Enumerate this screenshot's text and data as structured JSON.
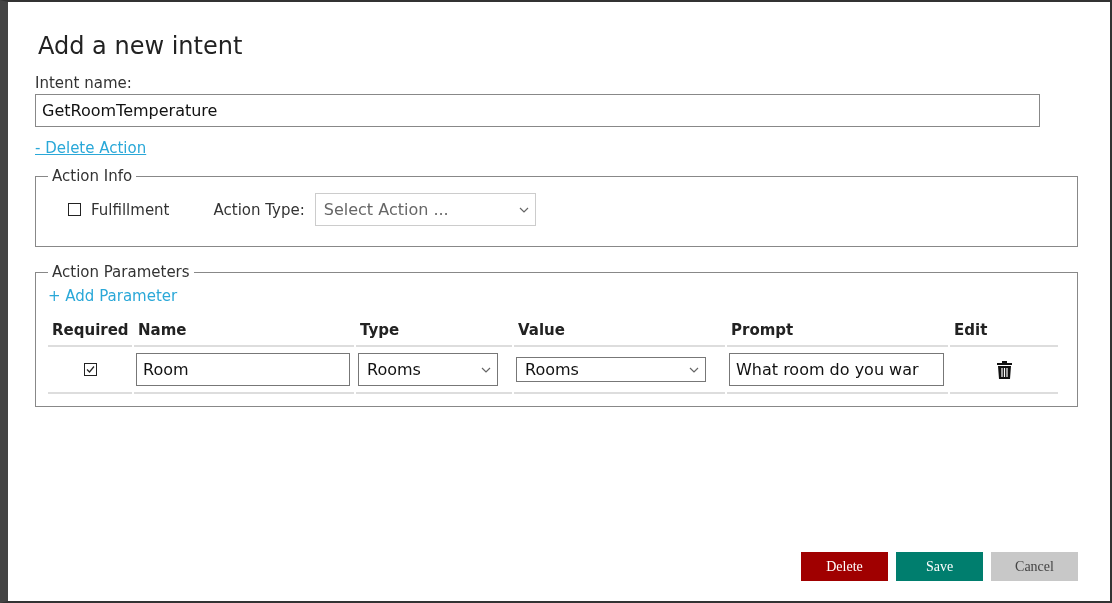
{
  "dialog": {
    "title": "Add a new intent"
  },
  "intent_name": {
    "label": "Intent name:",
    "value": "GetRoomTemperature"
  },
  "delete_action_link": "- Delete Action",
  "action_info": {
    "legend": "Action Info",
    "fulfillment": {
      "label": "Fulfillment",
      "checked": false
    },
    "action_type": {
      "label": "Action Type:",
      "placeholder": "Select Action ..."
    }
  },
  "action_parameters": {
    "legend": "Action Parameters",
    "add_link": "+ Add Parameter",
    "columns": [
      "Required",
      "Name",
      "Type",
      "Value",
      "Prompt",
      "Edit"
    ],
    "rows": [
      {
        "required": true,
        "name": "Room",
        "type": "Rooms",
        "value": "Rooms",
        "prompt": "What room do you war"
      }
    ]
  },
  "buttons": [
    {
      "label": "Delete",
      "kind": "danger"
    },
    {
      "label": "Save",
      "kind": "primary"
    },
    {
      "label": "Cancel",
      "kind": "secondary"
    }
  ]
}
